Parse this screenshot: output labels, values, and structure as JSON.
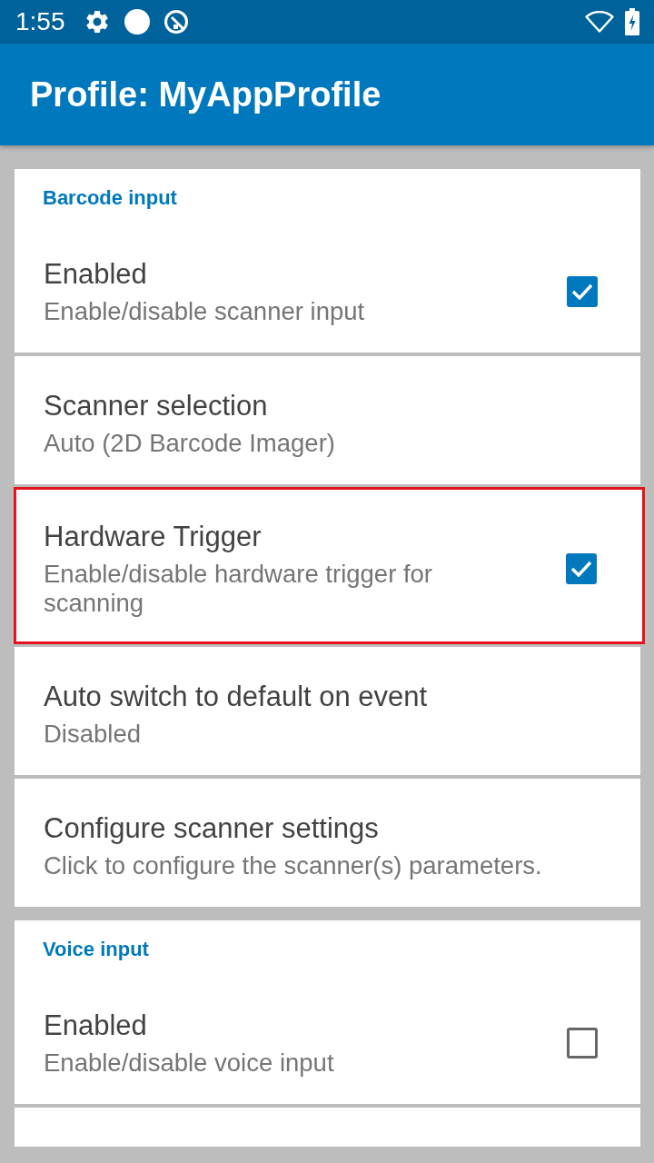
{
  "status_bar": {
    "time": "1:55"
  },
  "app_bar": {
    "title": "Profile: MyAppProfile"
  },
  "sections": [
    {
      "title": "Barcode input",
      "items": [
        {
          "kind": "checkbox",
          "title": "Enabled",
          "summary": "Enable/disable scanner input",
          "checked": true,
          "highlighted": false
        },
        {
          "kind": "text",
          "title": "Scanner selection",
          "summary": "Auto (2D Barcode Imager)",
          "highlighted": false
        },
        {
          "kind": "checkbox",
          "title": "Hardware Trigger",
          "summary": "Enable/disable hardware trigger for scanning",
          "checked": true,
          "highlighted": true
        },
        {
          "kind": "text",
          "title": "Auto switch to default on event",
          "summary": "Disabled",
          "highlighted": false
        },
        {
          "kind": "text",
          "title": "Configure scanner settings",
          "summary": "Click to configure the scanner(s) parameters.",
          "highlighted": false
        }
      ]
    },
    {
      "title": "Voice input",
      "items": [
        {
          "kind": "checkbox",
          "title": "Enabled",
          "summary": "Enable/disable voice input",
          "checked": false,
          "highlighted": false
        },
        {
          "kind": "partial"
        }
      ]
    }
  ]
}
